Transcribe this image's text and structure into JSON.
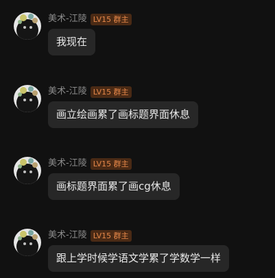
{
  "messages": [
    {
      "sender": "美术-江陵",
      "badge": "LV15 群主",
      "text": "我现在"
    },
    {
      "sender": "美术-江陵",
      "badge": "LV15 群主",
      "text": "画立绘画累了画标题界面休息"
    },
    {
      "sender": "美术-江陵",
      "badge": "LV15 群主",
      "text": "画标题界面累了画cg休息"
    },
    {
      "sender": "美术-江陵",
      "badge": "LV15 群主",
      "text": "跟上学时候学语文学累了学数学一样"
    }
  ],
  "icons": {
    "avatar": "user-avatar-icon"
  },
  "colors": {
    "background": "#111111",
    "bubble": "#272727",
    "badge_bg": "#4a2a15",
    "badge_text": "#e8894a",
    "name_text": "#8a8a8a"
  }
}
